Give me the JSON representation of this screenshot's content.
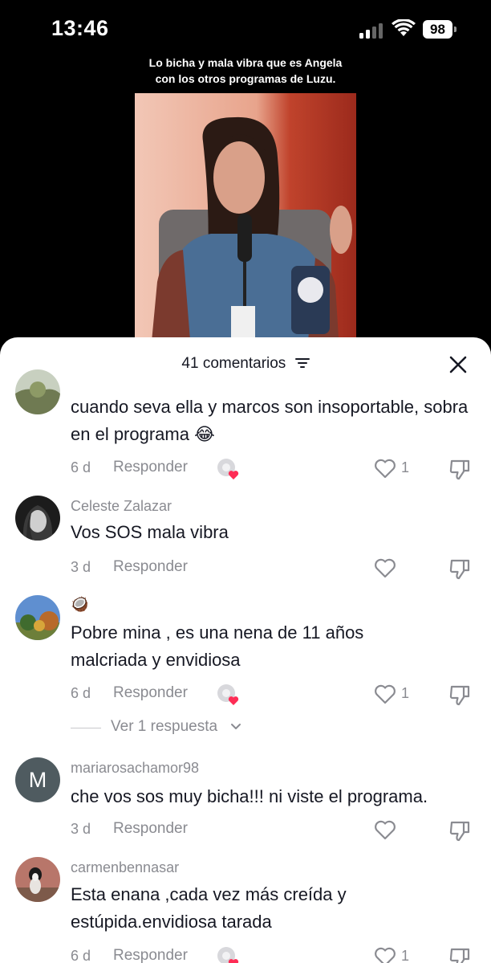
{
  "status": {
    "time": "13:46",
    "battery": "98"
  },
  "video": {
    "caption_line1": "Lo bicha y mala vibra que es Angela",
    "caption_line2": "con los otros programas de Luzu."
  },
  "comments_sheet": {
    "title": "41 comentarios",
    "reply_label": "Responder",
    "view_replies": "Ver 1 respuesta",
    "comments": [
      {
        "username": "",
        "text": "cuando seva ella y marcos son insoportable, sobra en el programa 😂",
        "date": "6 d",
        "likes": "1",
        "creator_liked": true
      },
      {
        "username": "Celeste Zalazar",
        "text": "Vos SOS mala vibra",
        "date": "3 d",
        "likes": "",
        "creator_liked": false
      },
      {
        "username": "🥥",
        "text": "Pobre mina , es una nena de 11 años malcriada y envidiosa",
        "date": "6 d",
        "likes": "1",
        "creator_liked": true
      },
      {
        "username": "mariarosachamor98",
        "text": "che vos sos muy bicha!!! ni viste el programa.",
        "date": "3 d",
        "likes": "",
        "creator_liked": false,
        "avatar_letter": "M"
      },
      {
        "username": "carmenbennasar",
        "text": "Esta enana ,cada vez más creída y estúpida.envidiosa tarada",
        "date": "6 d",
        "likes": "1",
        "creator_liked": true
      }
    ]
  },
  "colors": {
    "accent_heart": "#fe2c55",
    "muted": "#8a8b91",
    "text": "#161823"
  },
  "icons": [
    "signal-icon",
    "wifi-icon",
    "battery-icon",
    "filter-icon",
    "close-icon",
    "heart-icon",
    "dislike-icon",
    "creator-like-icon",
    "chevron-down-icon"
  ]
}
